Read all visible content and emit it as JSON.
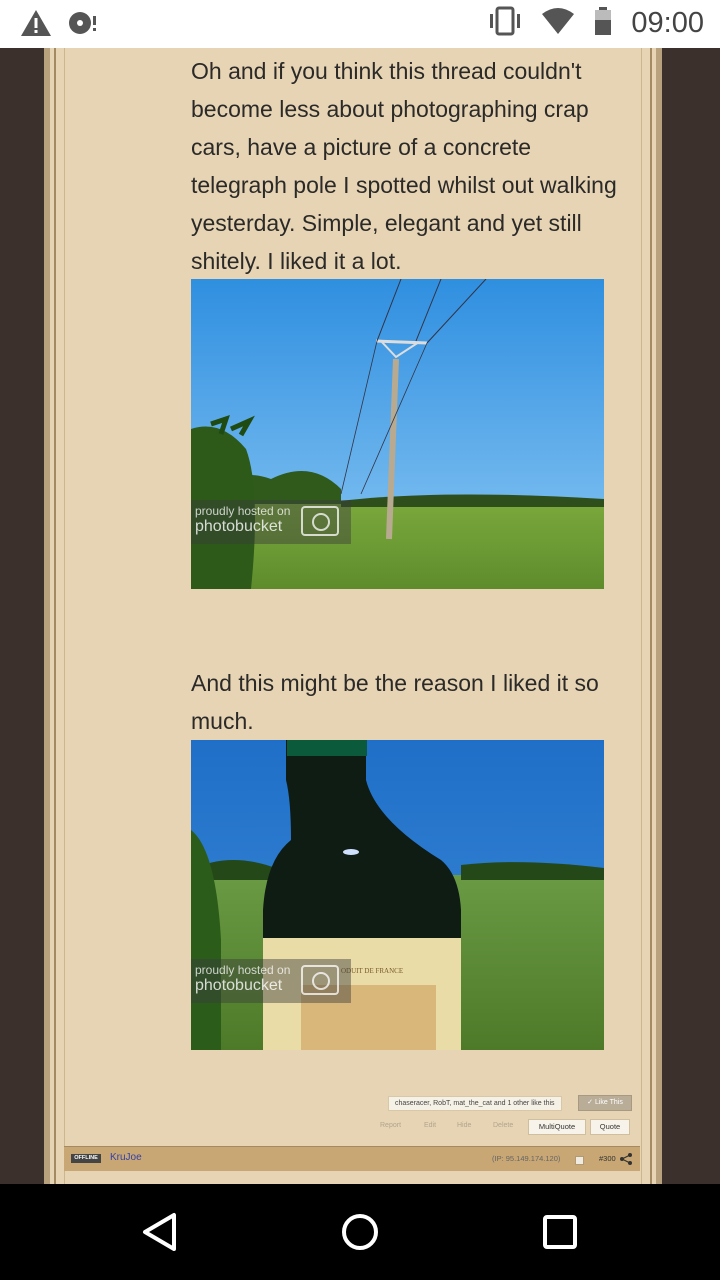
{
  "status_bar": {
    "time": "09:00",
    "icons": [
      "warning-icon",
      "sync-disc-icon",
      "vibrate-icon",
      "wifi-icon",
      "battery-icon"
    ]
  },
  "post": {
    "paragraph1": "Oh and if you think this thread couldn't become less about photographing crap cars, have a picture of a concrete telegraph pole I spotted whilst out walking yesterday. Simple, elegant and yet still shitely. I liked it a lot.",
    "paragraph2": "And this might be the reason I liked it so much.",
    "watermark": {
      "line1": "proudly hosted on",
      "line2": "photobucket"
    },
    "bottle_label_text": "ODUIT DE FRANCE"
  },
  "likes": {
    "text": "chaseracer, RobT, mat_the_cat and 1 other like this",
    "like_button": "Like This"
  },
  "actions": {
    "report": "Report",
    "edit": "Edit",
    "hide": "Hide",
    "delete": "Delete",
    "multiquote": "MultiQuote",
    "quote": "Quote"
  },
  "next_post": {
    "status": "OFFLINE",
    "username": "KruJoe",
    "ip": "(IP: 95.149.174.120)",
    "number": "#300"
  },
  "colors": {
    "page_bg": "#3b302b",
    "content_bg": "#e6d4b4",
    "userbar": "#c8a774",
    "username": "#3340a8"
  }
}
